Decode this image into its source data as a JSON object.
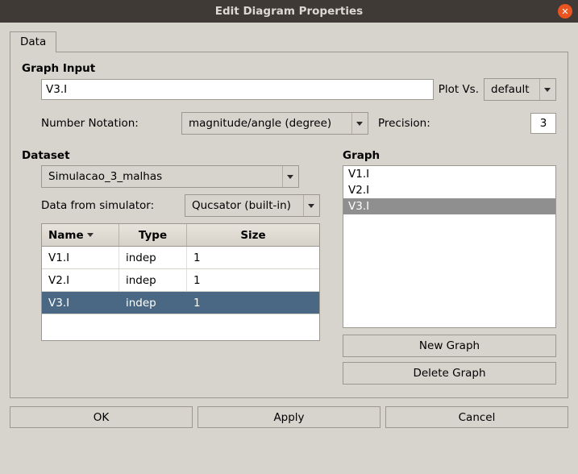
{
  "window": {
    "title": "Edit Diagram Properties"
  },
  "tabs": {
    "data_label": "Data"
  },
  "graph_input": {
    "label": "Graph Input",
    "value": "V3.I",
    "plot_vs_label": "Plot Vs.",
    "plot_vs_value": "default",
    "number_notation_label": "Number Notation:",
    "number_notation_value": "magnitude/angle (degree)",
    "precision_label": "Precision:",
    "precision_value": "3"
  },
  "dataset": {
    "label": "Dataset",
    "selected": "Simulacao_3_malhas",
    "from_sim_label": "Data from simulator:",
    "from_sim_value": "Qucsator (built-in)",
    "columns": {
      "name": "Name",
      "type": "Type",
      "size": "Size"
    },
    "rows": [
      {
        "name": "V1.I",
        "type": "indep",
        "size": "1",
        "selected": false
      },
      {
        "name": "V2.I",
        "type": "indep",
        "size": "1",
        "selected": false
      },
      {
        "name": "V3.I",
        "type": "indep",
        "size": "1",
        "selected": true
      }
    ]
  },
  "graph": {
    "label": "Graph",
    "items": [
      {
        "label": "V1.I",
        "selected": false
      },
      {
        "label": "V2.I",
        "selected": false
      },
      {
        "label": "V3.I",
        "selected": true
      }
    ],
    "new_label": "New Graph",
    "delete_label": "Delete Graph"
  },
  "buttons": {
    "ok": "OK",
    "apply": "Apply",
    "cancel": "Cancel"
  }
}
